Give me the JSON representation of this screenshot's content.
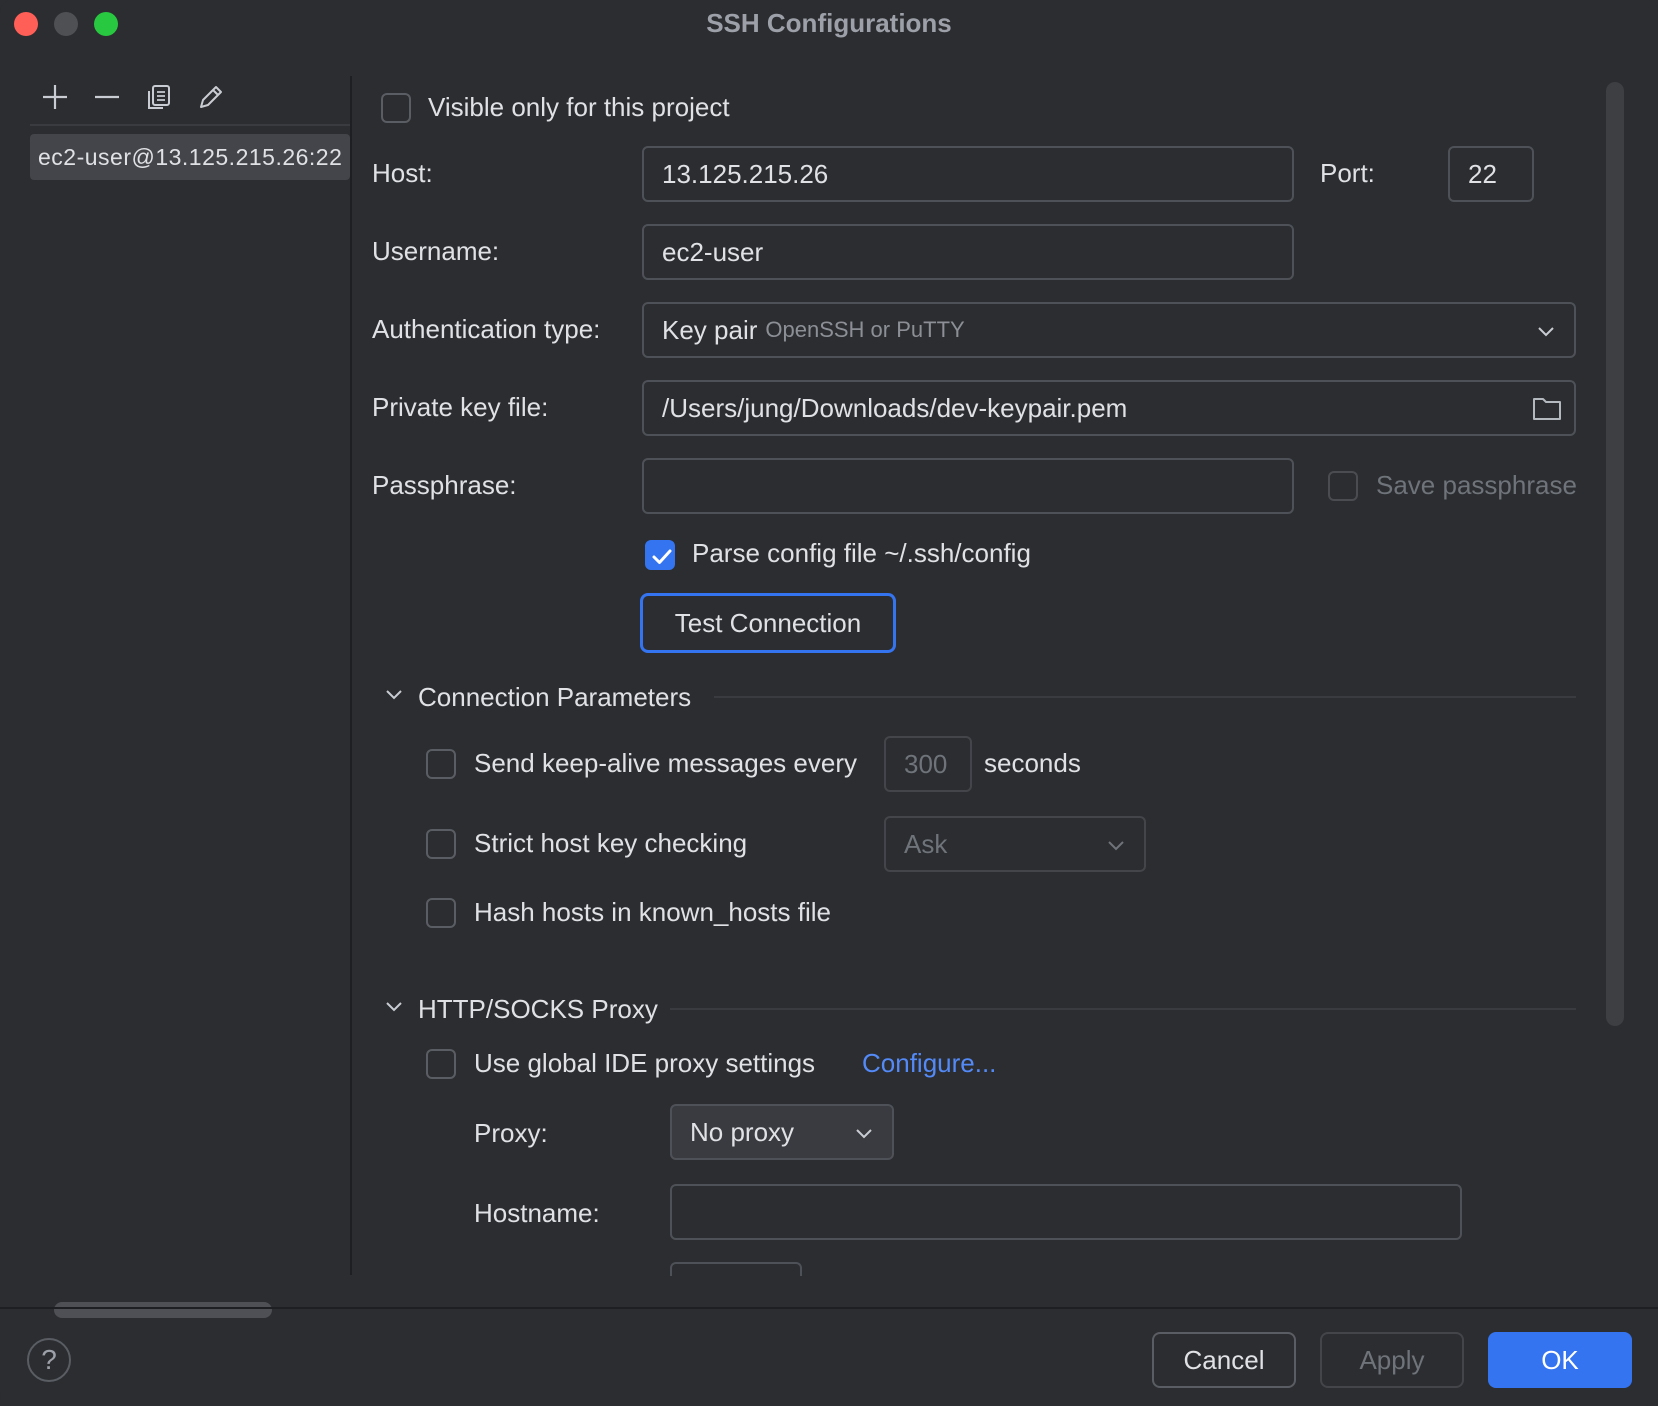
{
  "window": {
    "title": "SSH Configurations"
  },
  "left_panel": {
    "toolbar": [
      "add-icon",
      "remove-icon",
      "copy-icon",
      "edit-icon"
    ],
    "items": [
      {
        "label": "ec2-user@13.125.215.26:22"
      }
    ]
  },
  "form": {
    "visible_only_label": "Visible only for this project",
    "host_label": "Host:",
    "host_value": "13.125.215.26",
    "port_label": "Port:",
    "port_value": "22",
    "username_label": "Username:",
    "username_value": "ec2-user",
    "auth_label": "Authentication type:",
    "auth_value": "Key pair",
    "auth_hint": "OpenSSH or PuTTY",
    "key_label": "Private key file:",
    "key_value": "/Users/jung/Downloads/dev-keypair.pem",
    "passphrase_label": "Passphrase:",
    "passphrase_value": "",
    "save_passphrase_label": "Save passphrase",
    "parse_config_label": "Parse config file ~/.ssh/config",
    "test_connection_label": "Test Connection"
  },
  "connection_params": {
    "header": "Connection Parameters",
    "keepalive_label": "Send keep-alive messages every",
    "keepalive_value": "300",
    "keepalive_unit": "seconds",
    "strict_label": "Strict host key checking",
    "strict_value": "Ask",
    "hash_label": "Hash hosts in known_hosts file"
  },
  "proxy": {
    "header": "HTTP/SOCKS Proxy",
    "global_label": "Use global IDE proxy settings",
    "configure_link": "Configure...",
    "proxy_label": "Proxy:",
    "proxy_value": "No proxy",
    "hostname_label": "Hostname:",
    "hostname_value": ""
  },
  "footer": {
    "help": "?",
    "cancel": "Cancel",
    "apply": "Apply",
    "ok": "OK"
  },
  "colors": {
    "accent": "#3574f0",
    "background": "#2b2d30",
    "link": "#548af7"
  }
}
